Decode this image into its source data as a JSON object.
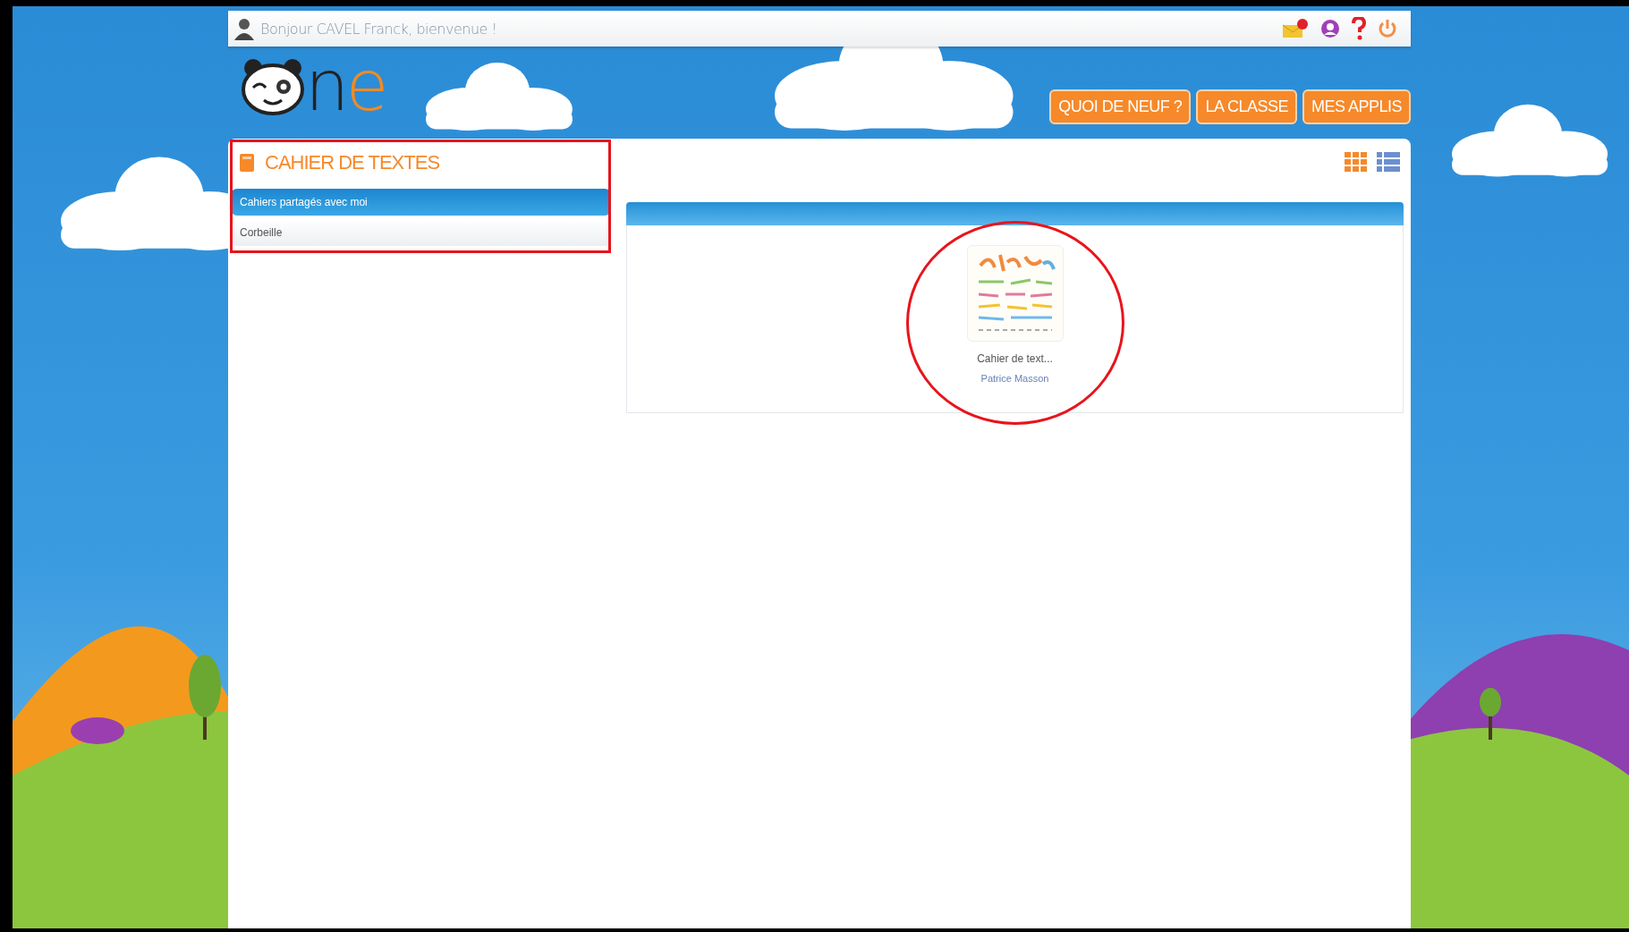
{
  "top_bar": {
    "greeting": "Bonjour CAVEL Franck, bienvenue !"
  },
  "logo": {
    "text": "ne"
  },
  "nav_buttons": [
    "QUOI DE NEUF ?",
    "LA CLASSE",
    "MES APPLIS"
  ],
  "sidebar": {
    "title": "CAHIER DE TEXTES",
    "items": [
      {
        "label": "Cahiers partagés avec moi",
        "selected": true
      },
      {
        "label": "Corbeille",
        "selected": false
      }
    ]
  },
  "view_toggle": [
    {
      "kind": "grid",
      "selected": true
    },
    {
      "kind": "list",
      "selected": false
    }
  ],
  "notebooks": [
    {
      "title": "Cahier de text...",
      "owner": "Patrice Masson"
    }
  ]
}
